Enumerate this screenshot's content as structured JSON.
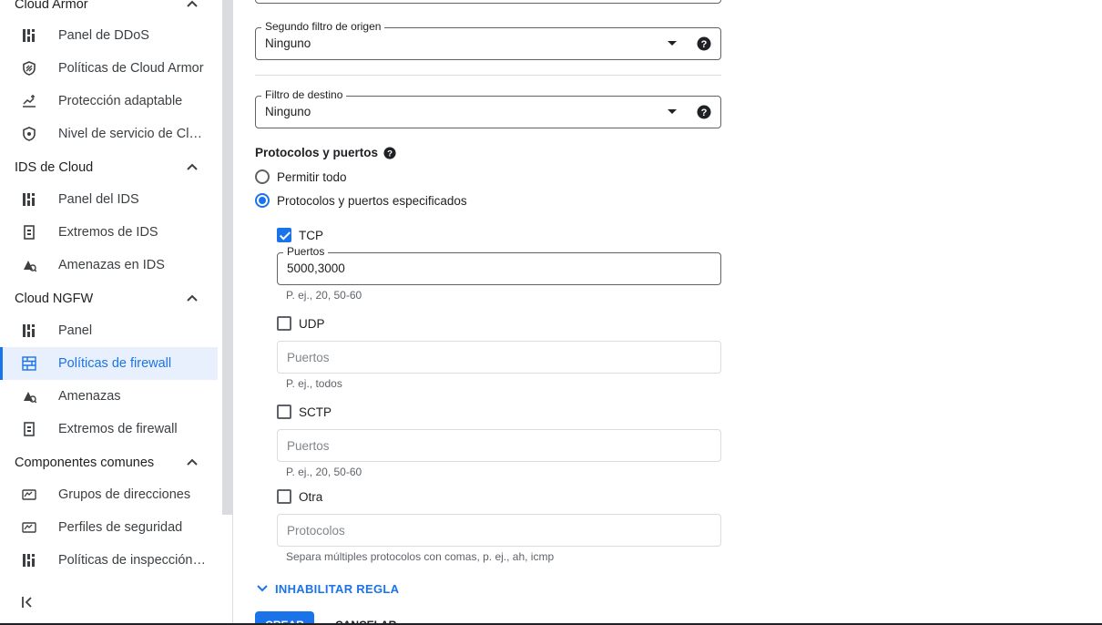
{
  "sidebar": {
    "sections": [
      {
        "title": "Cloud Armor",
        "items": [
          {
            "label": "Panel de DDoS",
            "icon": "dashboard-icon"
          },
          {
            "label": "Políticas de Cloud Armor",
            "icon": "shield-policy-icon"
          },
          {
            "label": "Protección adaptable",
            "icon": "adaptive-chart-icon"
          },
          {
            "label": "Nivel de servicio de Cloud Armor",
            "icon": "shield-icon"
          }
        ]
      },
      {
        "title": "IDS de Cloud",
        "items": [
          {
            "label": "Panel del IDS",
            "icon": "dashboard-icon"
          },
          {
            "label": "Extremos de IDS",
            "icon": "endpoint-icon"
          },
          {
            "label": "Amenazas en IDS",
            "icon": "threat-icon"
          }
        ]
      },
      {
        "title": "Cloud NGFW",
        "items": [
          {
            "label": "Panel",
            "icon": "dashboard-icon"
          },
          {
            "label": "Políticas de firewall",
            "icon": "firewall-icon"
          },
          {
            "label": "Amenazas",
            "icon": "threat-icon"
          },
          {
            "label": "Extremos de firewall",
            "icon": "endpoint-icon"
          }
        ]
      },
      {
        "title": "Componentes comunes",
        "items": [
          {
            "label": "Grupos de direcciones",
            "icon": "address-group-icon"
          },
          {
            "label": "Perfiles de seguridad",
            "icon": "security-profile-icon"
          },
          {
            "label": "Políticas de inspección TLS",
            "icon": "dashboard-icon"
          }
        ]
      }
    ]
  },
  "form": {
    "second_source_filter": {
      "label": "Segundo filtro de origen",
      "value": "Ninguno"
    },
    "destination_filter": {
      "label": "Filtro de destino",
      "value": "Ninguno"
    },
    "protocols_title": "Protocolos y puertos",
    "radio_allow_all": "Permitir todo",
    "radio_specified": "Protocolos y puertos especificados",
    "tcp": {
      "label": "TCP",
      "checked": true,
      "ports_label": "Puertos",
      "ports_value": "5000,3000",
      "hint": "P. ej., 20, 50-60"
    },
    "udp": {
      "label": "UDP",
      "checked": false,
      "placeholder": "Puertos",
      "hint": "P. ej., todos"
    },
    "sctp": {
      "label": "SCTP",
      "checked": false,
      "placeholder": "Puertos",
      "hint": "P. ej., 20, 50-60"
    },
    "other": {
      "label": "Otra",
      "checked": false,
      "placeholder": "Protocolos",
      "hint": "Separa múltiples protocolos con comas, p. ej., ah, icmp"
    },
    "disable_rule": "INHABILITAR REGLA",
    "create_button": "CREAR",
    "cancel_button": "CANCELAR"
  },
  "colors": {
    "accent": "#1a73e8",
    "active_bg": "#e8f0fe"
  }
}
